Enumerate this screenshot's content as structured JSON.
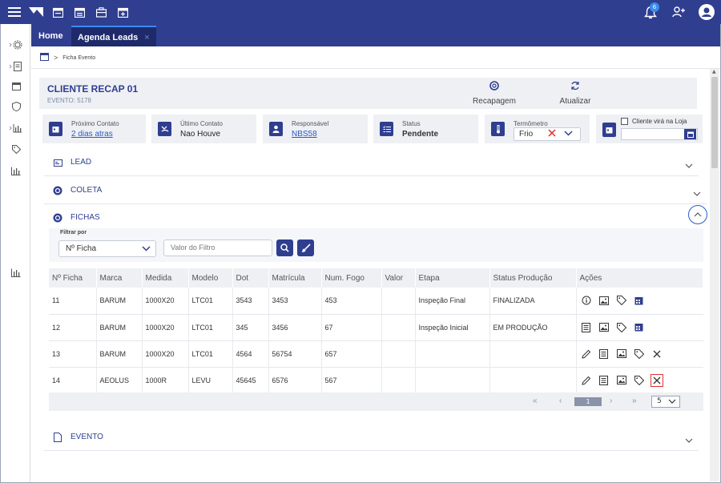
{
  "topbar": {
    "notification_count": "6"
  },
  "tabs": [
    {
      "label": "Home"
    },
    {
      "label": "Agenda Leads",
      "close": "×"
    }
  ],
  "breadcrumb": {
    "separator": ">",
    "current": "Ficha Evento"
  },
  "client": {
    "name": "CLIENTE RECAP 01",
    "event": "EVENTO: 5178"
  },
  "header_actions": {
    "recapagem": "Recapagem",
    "atualizar": "Atualizar"
  },
  "cards": {
    "proximo_contato": {
      "label": "Próximo Contato",
      "value": "2 dias atras"
    },
    "ultimo_contato": {
      "label": "Último Contato",
      "value": "Nao Houve"
    },
    "responsavel": {
      "label": "Responsável",
      "value": "NBS58"
    },
    "status": {
      "label": "Status",
      "value": "Pendente"
    },
    "termometro": {
      "label": "Termômetro",
      "value": "Frio"
    },
    "cliente_loja": {
      "label": "Cliente virá na Loja"
    }
  },
  "sections": {
    "lead": "LEAD",
    "coleta": "COLETA",
    "fichas": "FICHAS",
    "evento": "EVENTO"
  },
  "filter": {
    "label": "Filtrar por",
    "select_value": "Nº Ficha",
    "input_placeholder": "Valor do Filtro"
  },
  "table": {
    "columns": [
      "Nº Ficha",
      "Marca",
      "Medida",
      "Modelo",
      "Dot",
      "Matrícula",
      "Num. Fogo",
      "Valor",
      "Etapa",
      "Status Produção",
      "Ações"
    ],
    "rows": [
      {
        "cells": [
          "11",
          "BARUM",
          "1000X20",
          "LTC01",
          "3543",
          "3453",
          "453",
          "",
          "Inspeção Final",
          "FINALIZADA"
        ],
        "actions": [
          "info-icon",
          "image-icon",
          "tag-icon",
          "calendar-icon"
        ]
      },
      {
        "cells": [
          "12",
          "BARUM",
          "1000X20",
          "LTC01",
          "345",
          "3456",
          "67",
          "",
          "Inspeção Inicial",
          "EM PRODUÇÃO"
        ],
        "actions": [
          "list-icon",
          "image-icon",
          "tag-icon",
          "calendar-icon"
        ]
      },
      {
        "cells": [
          "13",
          "BARUM",
          "1000X20",
          "LTC01",
          "4564",
          "56754",
          "657",
          "",
          "",
          ""
        ],
        "actions": [
          "edit-icon",
          "list-icon",
          "image-icon",
          "tag-icon",
          "close-icon"
        ]
      },
      {
        "cells": [
          "14",
          "AEOLUS",
          "1000R",
          "LEVU",
          "45645",
          "6576",
          "567",
          "",
          "",
          ""
        ],
        "actions": [
          "edit-icon",
          "list-icon",
          "image-icon",
          "tag-icon",
          "close-icon"
        ]
      }
    ]
  },
  "pagination": {
    "first": "«",
    "prev": "‹",
    "current": "1",
    "next": "›",
    "last": "»",
    "page_size": "5"
  },
  "colors": {
    "primary": "#2f3e8f",
    "accent": "#3b8bf0",
    "danger": "#d33"
  }
}
